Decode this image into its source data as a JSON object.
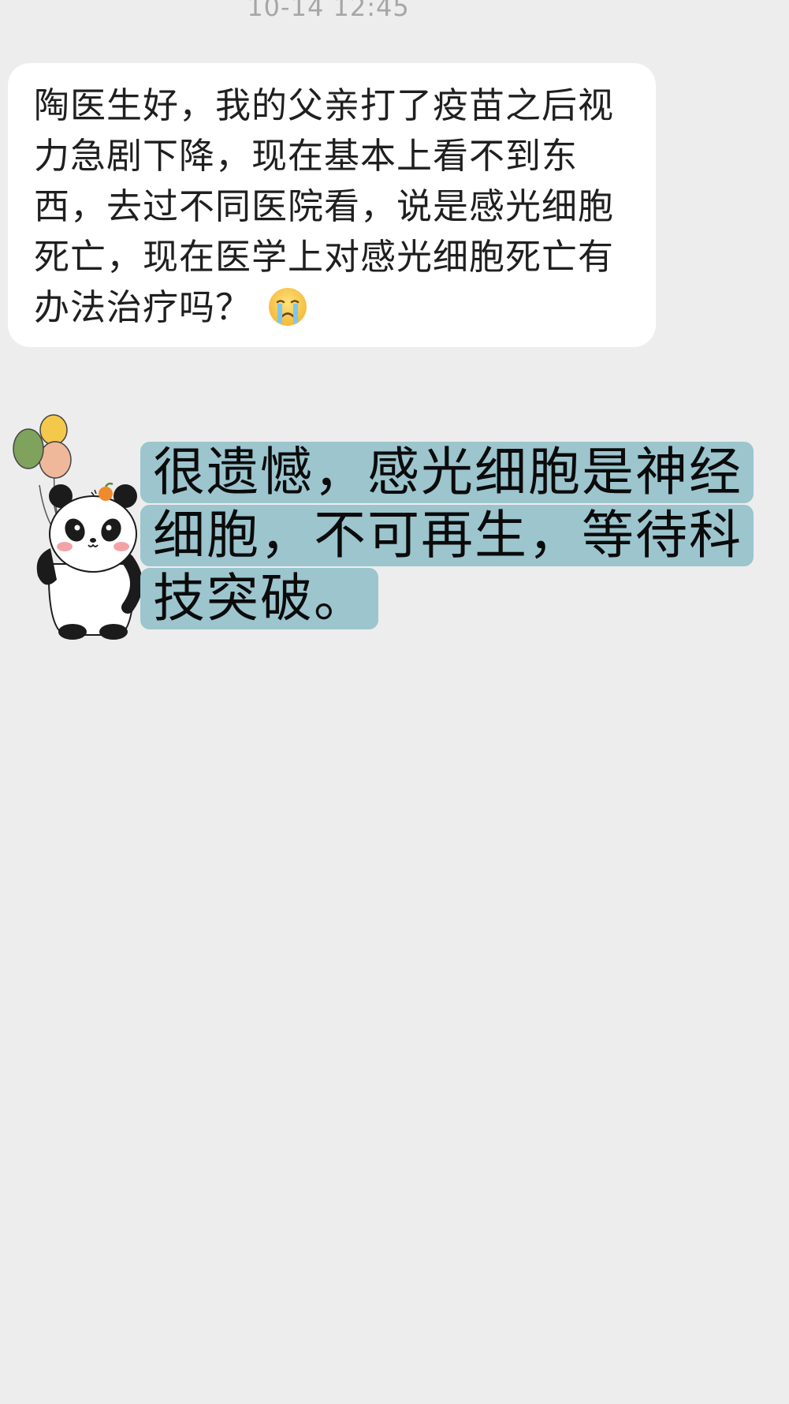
{
  "chat": {
    "timestamp": "10-14 12:45",
    "incoming_message": {
      "text": "陶医生好，我的父亲打了疫苗之后视力急剧下降，现在基本上看不到东西，去过不同医院看，说是感光细胞死亡，现在医学上对感光细胞死亡有办法治疗吗？",
      "emoji": "crying-face-emoji"
    },
    "reply": {
      "sticker": "panda-with-balloons-sticker",
      "lines": [
        "很遗憾，感光细胞是神经",
        "细胞，不可再生，等待科",
        "技突破。"
      ]
    }
  },
  "colors": {
    "background": "#ededed",
    "incoming_bubble": "#ffffff",
    "reply_highlight": "#9cc5ce",
    "timestamp_text": "#a6a6a6"
  }
}
